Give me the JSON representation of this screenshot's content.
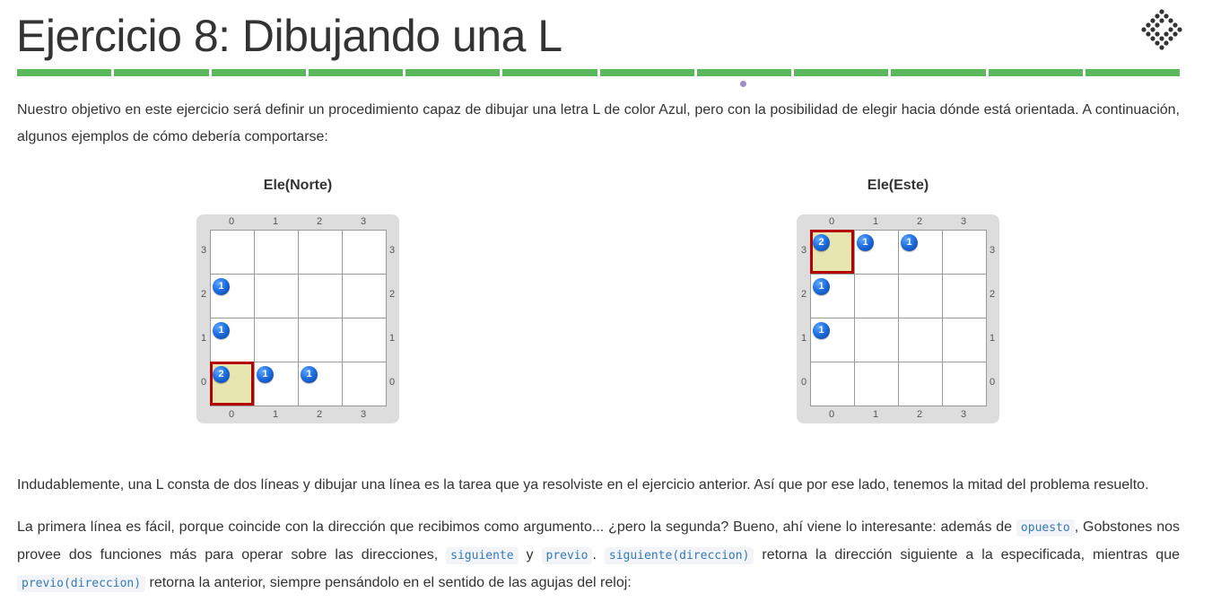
{
  "header": {
    "title": "Ejercicio 8: Dibujando una L",
    "progress_segments": 12,
    "progress_color": "#5cb85c"
  },
  "intro": {
    "text": "Nuestro objetivo en este ejercicio será definir un procedimiento capaz de dibujar una letra L de color Azul, pero con la posibilidad de elegir hacia dónde está orientada. A continuación, algunos ejemplos de cómo debería comportarse:"
  },
  "boards": [
    {
      "title": "Ele(Norte)",
      "columns": [
        "0",
        "1",
        "2",
        "3"
      ],
      "rows": [
        "3",
        "2",
        "1",
        "0"
      ],
      "head": {
        "col": 0,
        "row": 0
      },
      "marbles": [
        {
          "col": 0,
          "row": 2,
          "count": "1"
        },
        {
          "col": 0,
          "row": 1,
          "count": "1"
        },
        {
          "col": 0,
          "row": 0,
          "count": "2"
        },
        {
          "col": 1,
          "row": 0,
          "count": "1"
        },
        {
          "col": 2,
          "row": 0,
          "count": "1"
        }
      ]
    },
    {
      "title": "Ele(Este)",
      "columns": [
        "0",
        "1",
        "2",
        "3"
      ],
      "rows": [
        "3",
        "2",
        "1",
        "0"
      ],
      "head": {
        "col": 0,
        "row": 3
      },
      "marbles": [
        {
          "col": 0,
          "row": 3,
          "count": "2"
        },
        {
          "col": 1,
          "row": 3,
          "count": "1"
        },
        {
          "col": 2,
          "row": 3,
          "count": "1"
        },
        {
          "col": 0,
          "row": 2,
          "count": "1"
        },
        {
          "col": 0,
          "row": 1,
          "count": "1"
        }
      ]
    }
  ],
  "para2": {
    "text": "Indudablemente, una L consta de dos líneas y dibujar una línea es la tarea que ya resolviste en el ejercicio anterior. Así que por ese lado, tenemos la mitad del problema resuelto."
  },
  "para3": {
    "t1": "La primera línea es fácil, porque coincide con la dirección que recibimos como argumento... ¿pero la segunda? Bueno, ahí viene lo interesante: además de ",
    "c1": "opuesto",
    "t2": ", Gobstones nos provee dos funciones más para operar sobre las direcciones, ",
    "c2": "siguiente",
    "t3": " y ",
    "c3": "previo",
    "t4": ". ",
    "c4": "siguiente(direccion)",
    "t5": " retorna la dirección siguiente a la especificada, mientras que ",
    "c5": "previo(direccion)",
    "t6": " retorna la anterior, siempre pensándolo en el sentido de las agujas del reloj:"
  }
}
